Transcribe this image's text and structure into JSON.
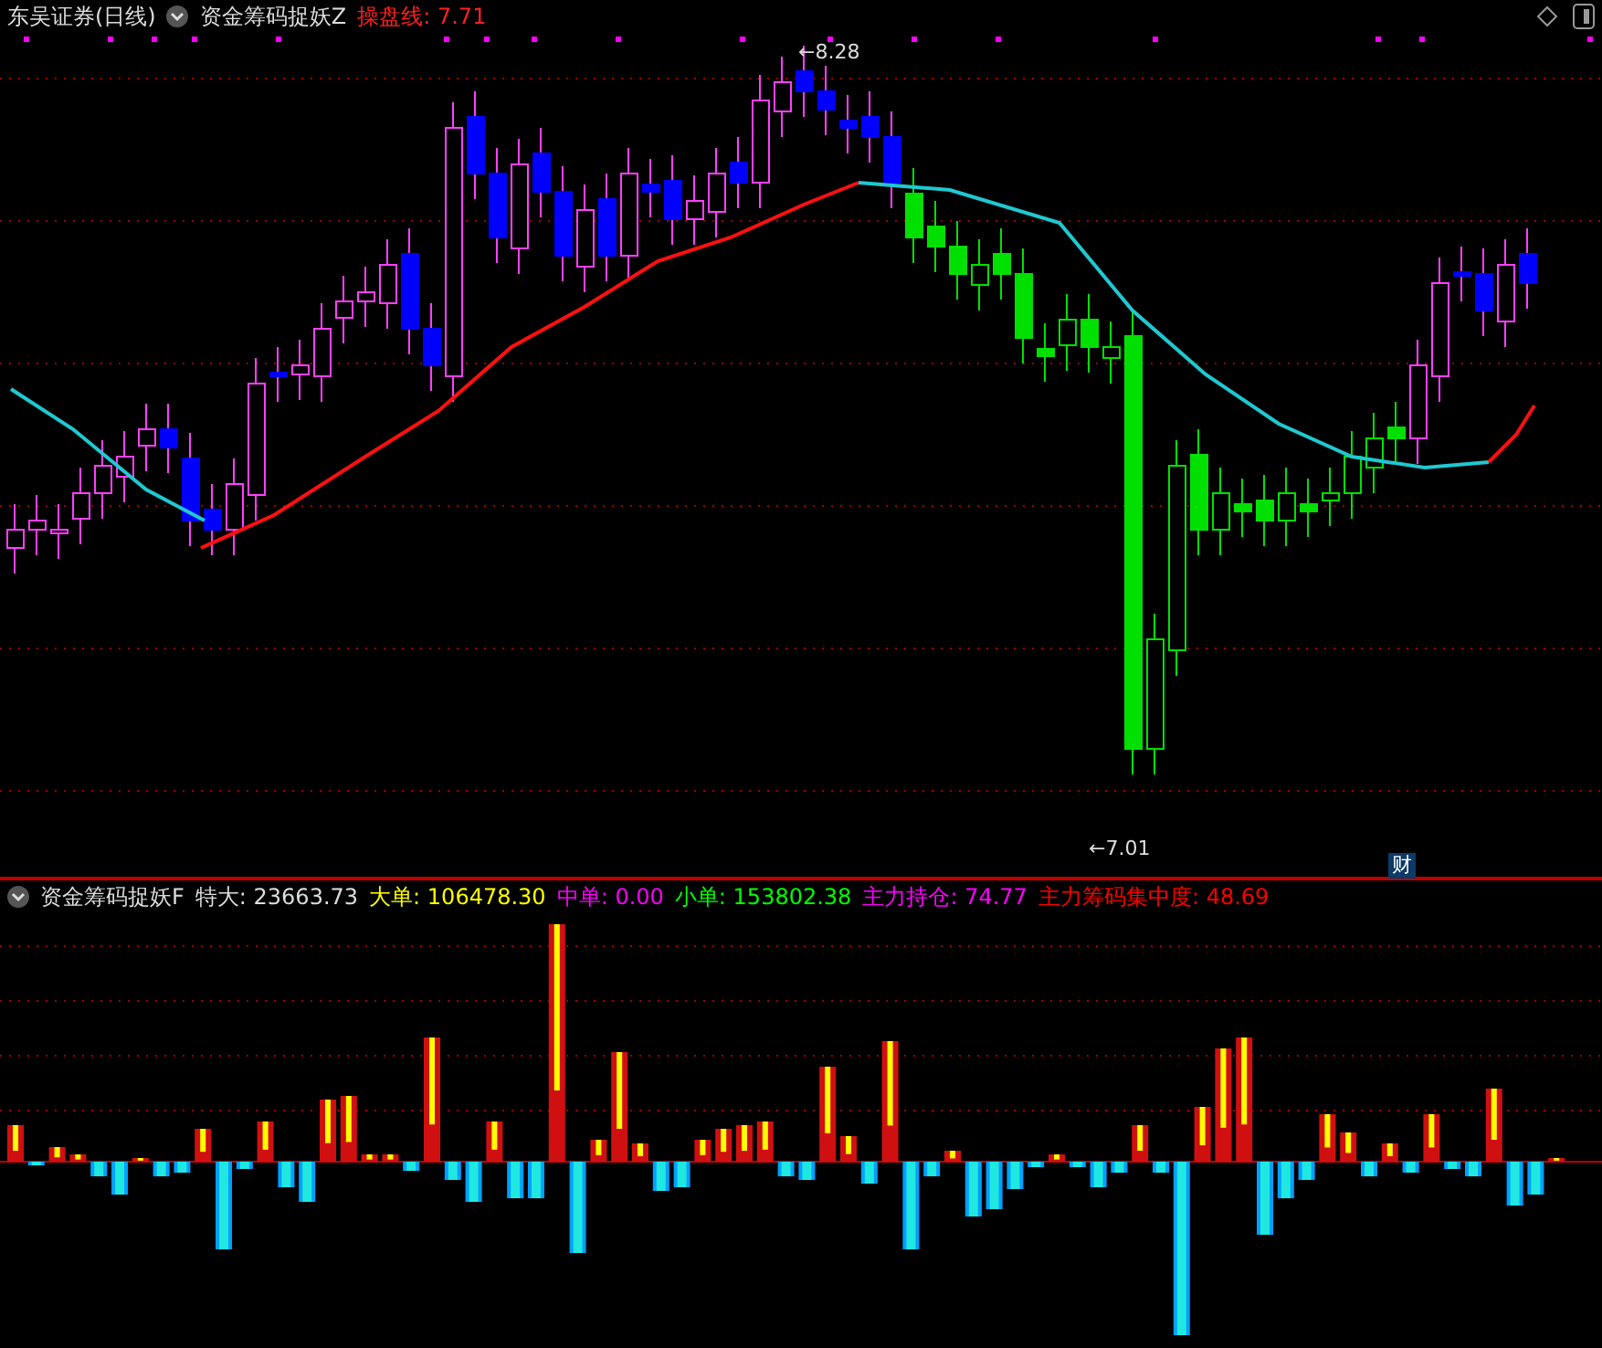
{
  "main_panel": {
    "security": "东吴证券(日线)",
    "indicator": "资金筹码捉妖Z",
    "line_label": "操盘线:",
    "line_value": "7.71",
    "high_label": "←8.28",
    "low_label": "←7.01",
    "badge": "财"
  },
  "volume_panel": {
    "indicator": "资金筹码捉妖F",
    "fields": [
      {
        "label": "特大:",
        "value": "23663.73",
        "color": "#dcdcdc"
      },
      {
        "label": "大单:",
        "value": "106478.30",
        "color": "#ffff00"
      },
      {
        "label": "中单:",
        "value": "0.00",
        "color": "#ff00ff"
      },
      {
        "label": "小单:",
        "value": "153802.38",
        "color": "#00ff00"
      },
      {
        "label": "主力持仓:",
        "value": "74.77",
        "color": "#ff00ff"
      },
      {
        "label": "主力筹码集中度:",
        "value": "48.69",
        "color": "#ff0000"
      }
    ]
  }
}
